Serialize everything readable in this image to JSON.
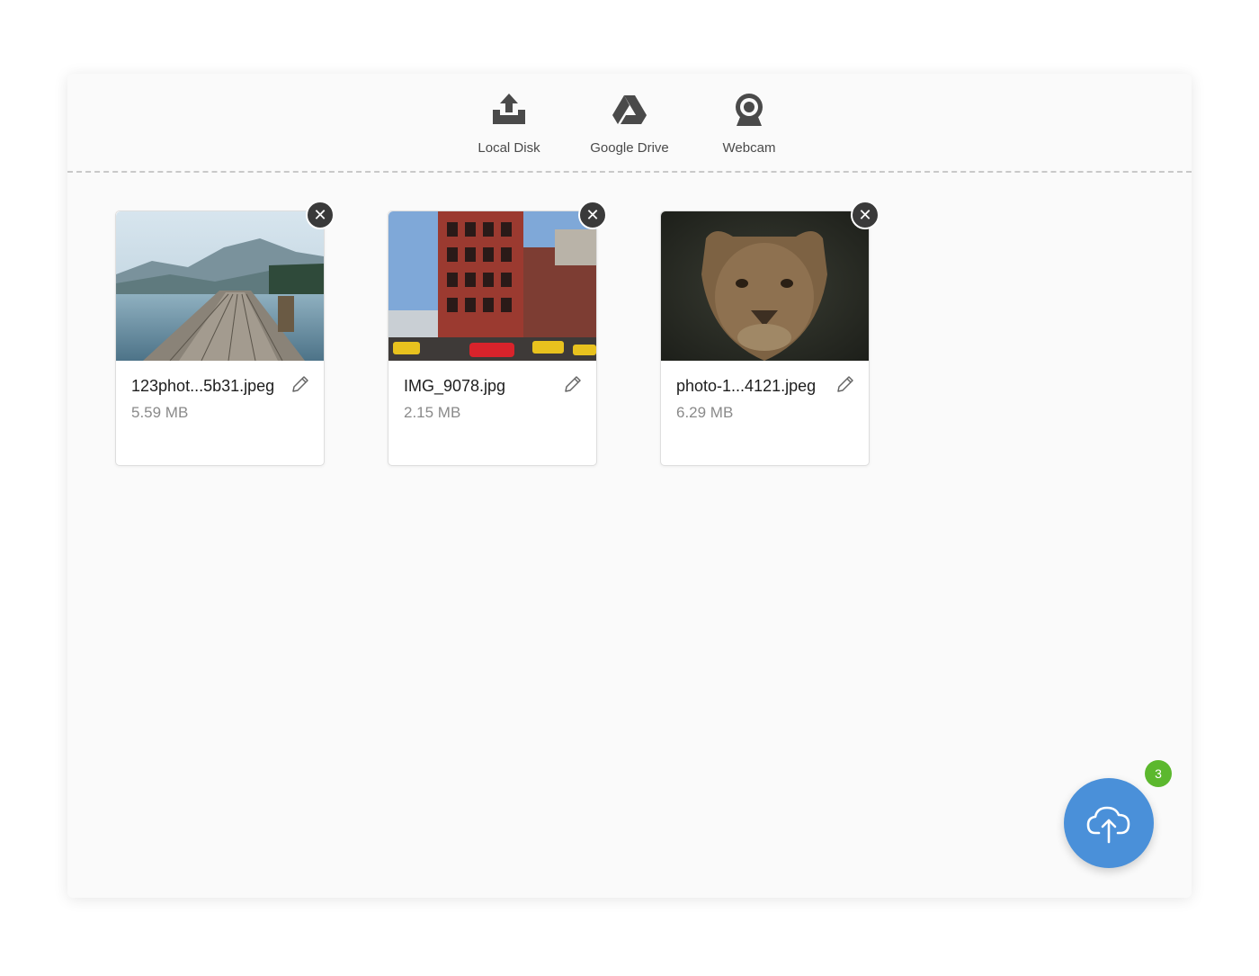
{
  "sources": [
    {
      "label": "Local Disk",
      "icon": "upload-tray-icon"
    },
    {
      "label": "Google Drive",
      "icon": "google-drive-icon"
    },
    {
      "label": "Webcam",
      "icon": "webcam-icon"
    }
  ],
  "files": [
    {
      "name": "123phot...5b31.jpeg",
      "size": "5.59 MB",
      "thumbnail": "lake-dock-photo"
    },
    {
      "name": "IMG_9078.jpg",
      "size": "2.15 MB",
      "thumbnail": "city-street-photo"
    },
    {
      "name": "photo-1...4121.jpeg",
      "size": "6.29 MB",
      "thumbnail": "lioness-photo"
    }
  ],
  "remove_label": "✕",
  "upload": {
    "icon": "cloud-upload-icon",
    "count": "3"
  },
  "colors": {
    "accent": "#4a90d9",
    "badge": "#5cb82e",
    "remove": "#3a3a3a"
  }
}
